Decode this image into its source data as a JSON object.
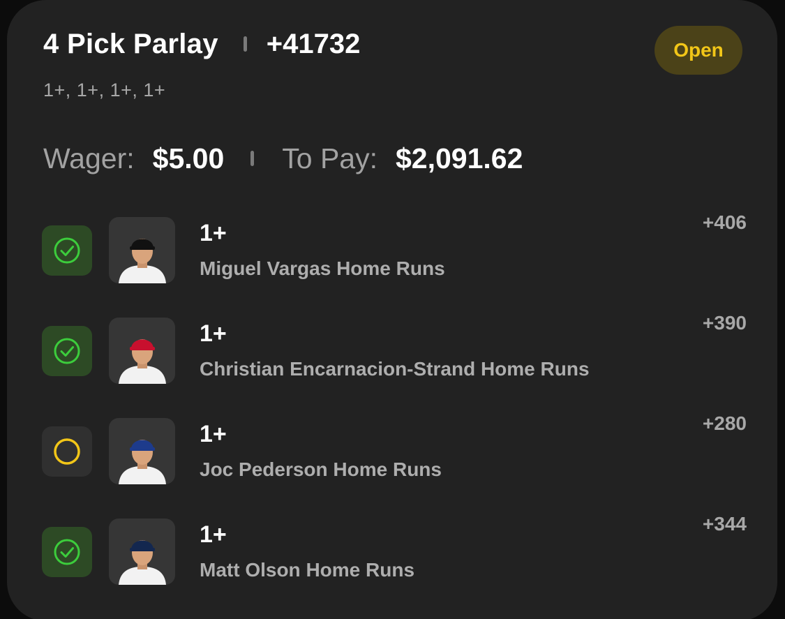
{
  "header": {
    "title": "4 Pick Parlay",
    "total_odds": "+41732",
    "status": "Open",
    "subtitle": "1+, 1+, 1+, 1+"
  },
  "bet": {
    "wager_label": "Wager:",
    "wager_value": "$5.00",
    "payout_label": "To Pay:",
    "payout_value": "$2,091.62"
  },
  "legs": [
    {
      "line": "1+",
      "market": "Miguel Vargas Home Runs",
      "odds": "+406",
      "status": "won",
      "status_icon": "check-circle-icon",
      "cap_color": "#111111",
      "jersey_color": "#f2f2f2"
    },
    {
      "line": "1+",
      "market": "Christian Encarnacion-Strand Home Runs",
      "odds": "+390",
      "status": "won",
      "status_icon": "check-circle-icon",
      "cap_color": "#c8102e",
      "jersey_color": "#f2f2f2"
    },
    {
      "line": "1+",
      "market": "Joc Pederson Home Runs",
      "odds": "+280",
      "status": "pending",
      "status_icon": "open-circle-icon",
      "cap_color": "#1d3b8c",
      "jersey_color": "#f2f2f2"
    },
    {
      "line": "1+",
      "market": "Matt Olson Home Runs",
      "odds": "+344",
      "status": "won",
      "status_icon": "check-circle-icon",
      "cap_color": "#13274f",
      "jersey_color": "#f2f2f2"
    }
  ],
  "colors": {
    "won_green": "#3ccd3c",
    "pending_yellow": "#f2c618",
    "card_bg": "#222222"
  }
}
